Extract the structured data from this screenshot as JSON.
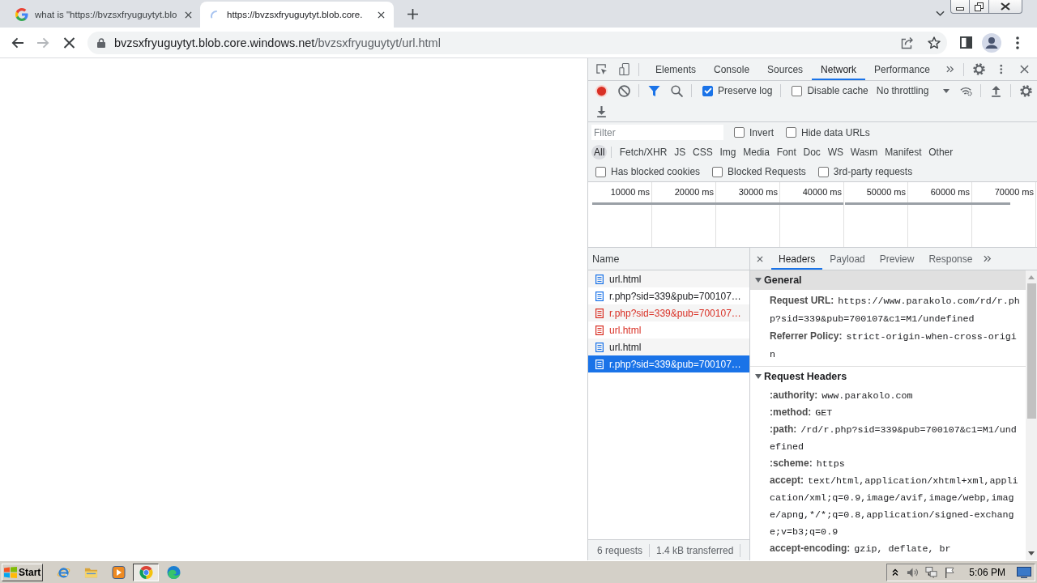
{
  "browser": {
    "tabs": [
      {
        "title": "what is \"https://bvzsxfryuguytyt.blo",
        "selected": false,
        "loading": false
      },
      {
        "title": "https://bvzsxfryuguytyt.blob.core.",
        "selected": true,
        "loading": true
      }
    ],
    "nav": [
      {
        "kind": "back",
        "disabled": false
      },
      {
        "kind": "forward",
        "disabled": true
      },
      {
        "kind": "stop",
        "disabled": false
      }
    ],
    "address": {
      "host": "bvzsxfryuguytyt.blob.core.windows.net",
      "path": "/bvzsxfryuguytyt/url.html"
    }
  },
  "devtools": {
    "panels": [
      {
        "label": "Elements",
        "selected": false
      },
      {
        "label": "Console",
        "selected": false
      },
      {
        "label": "Sources",
        "selected": false
      },
      {
        "label": "Network",
        "selected": true
      },
      {
        "label": "Performance",
        "selected": false
      }
    ],
    "recording": true,
    "options": [
      {
        "label": "Preserve log",
        "checked": true
      },
      {
        "label": "Disable cache",
        "checked": false
      }
    ],
    "throttling": "No throttling",
    "filter": {
      "placeholder": "Filter"
    },
    "filter_options": [
      {
        "label": "Invert",
        "checked": false
      },
      {
        "label": "Hide data URLs",
        "checked": false
      }
    ],
    "types": [
      {
        "label": "All",
        "selected": true
      },
      {
        "label": "Fetch/XHR",
        "selected": false
      },
      {
        "label": "JS",
        "selected": false
      },
      {
        "label": "CSS",
        "selected": false
      },
      {
        "label": "Img",
        "selected": false
      },
      {
        "label": "Media",
        "selected": false
      },
      {
        "label": "Font",
        "selected": false
      },
      {
        "label": "Doc",
        "selected": false
      },
      {
        "label": "WS",
        "selected": false
      },
      {
        "label": "Wasm",
        "selected": false
      },
      {
        "label": "Manifest",
        "selected": false
      },
      {
        "label": "Other",
        "selected": false
      }
    ],
    "extra_filters": [
      {
        "label": "Has blocked cookies",
        "checked": false
      },
      {
        "label": "Blocked Requests",
        "checked": false
      },
      {
        "label": "3rd-party requests",
        "checked": false
      }
    ],
    "timeline_ticks": [
      "10000 ms",
      "20000 ms",
      "30000 ms",
      "40000 ms",
      "50000 ms",
      "60000 ms",
      "70000 ms"
    ],
    "requests": {
      "column": "Name",
      "rows": [
        {
          "name": "url.html",
          "failed": false,
          "selected": false
        },
        {
          "name": "r.php?sid=339&pub=700107…",
          "failed": false,
          "selected": false
        },
        {
          "name": "r.php?sid=339&pub=700107…",
          "failed": true,
          "selected": false
        },
        {
          "name": "url.html",
          "failed": true,
          "selected": false
        },
        {
          "name": "url.html",
          "failed": false,
          "selected": false
        },
        {
          "name": "r.php?sid=339&pub=700107…",
          "failed": false,
          "selected": true
        }
      ]
    },
    "summary": [
      "6 requests",
      "1.4 kB transferred"
    ],
    "detail_tabs": [
      {
        "label": "Headers",
        "selected": true
      },
      {
        "label": "Payload",
        "selected": false
      },
      {
        "label": "Preview",
        "selected": false
      },
      {
        "label": "Response",
        "selected": false
      }
    ],
    "sections": [
      {
        "title": "General",
        "expanded": true,
        "highlighted": true,
        "headers": [
          {
            "name": "Request URL:",
            "value": "https://www.parakolo.com/rd/r.php?sid=339&pub=700107&c1=M1/undefined"
          },
          {
            "name": "Referrer Policy:",
            "value": "strict-origin-when-cross-origin"
          }
        ]
      },
      {
        "title": "Request Headers",
        "expanded": true,
        "highlighted": false,
        "headers": [
          {
            "name": ":authority:",
            "value": "www.parakolo.com"
          },
          {
            "name": ":method:",
            "value": "GET"
          },
          {
            "name": ":path:",
            "value": "/rd/r.php?sid=339&pub=700107&c1=M1/undefined"
          },
          {
            "name": ":scheme:",
            "value": "https"
          },
          {
            "name": "accept:",
            "value": "text/html,application/xhtml+xml,application/xml;q=0.9,image/avif,image/webp,image/apng,*/*;q=0.8,application/signed-exchange;v=b3;q=0.9"
          },
          {
            "name": "accept-encoding:",
            "value": "gzip, deflate, br"
          }
        ]
      }
    ]
  },
  "taskbar": {
    "start": "Start",
    "apps": [
      {
        "kind": "ie",
        "selected": false
      },
      {
        "kind": "explorer",
        "selected": false
      },
      {
        "kind": "media",
        "selected": false
      },
      {
        "kind": "chrome",
        "selected": true
      },
      {
        "kind": "edge",
        "selected": false
      }
    ],
    "clock": "5:06 PM"
  }
}
